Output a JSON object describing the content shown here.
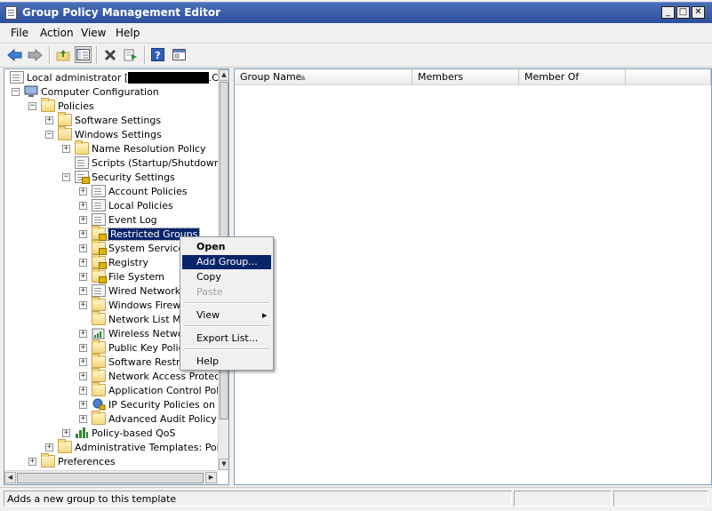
{
  "window": {
    "title": "Group Policy Management Editor"
  },
  "caption_buttons": {
    "minimize": "_",
    "maximize": "□",
    "close": "✕"
  },
  "menubar": [
    "File",
    "Action",
    "View",
    "Help"
  ],
  "toolbar": [
    "back-icon",
    "forward-icon",
    "up-folder-icon",
    "show-hide-tree-icon",
    "delete-icon",
    "export-list-icon",
    "help-icon",
    "properties-icon"
  ],
  "tree": {
    "root": {
      "prefix": "Local administrator [",
      "redacted": "XXXXXXXXXXXX",
      "suffix": ".COM] P"
    },
    "items": [
      {
        "label": "Computer Configuration"
      },
      {
        "label": "Policies"
      },
      {
        "label": "Software Settings"
      },
      {
        "label": "Windows Settings"
      },
      {
        "label": "Name Resolution Policy"
      },
      {
        "label": "Scripts (Startup/Shutdown)"
      },
      {
        "label": "Security Settings"
      },
      {
        "label": "Account Policies"
      },
      {
        "label": "Local Policies"
      },
      {
        "label": "Event Log"
      },
      {
        "label": "Restricted Groups"
      },
      {
        "label": "System Services"
      },
      {
        "label": "Registry"
      },
      {
        "label": "File System"
      },
      {
        "label": "Wired Network ("
      },
      {
        "label": "Windows Firewa"
      },
      {
        "label": "Network List Ma"
      },
      {
        "label": "Wireless Networ"
      },
      {
        "label": "Public Key Policie"
      },
      {
        "label": "Software Restric"
      },
      {
        "label": "Network Access Protecti"
      },
      {
        "label": "Application Control Polici"
      },
      {
        "label": "IP Security Policies on Ac"
      },
      {
        "label": "Advanced Audit Policy C"
      },
      {
        "label": "Policy-based QoS"
      },
      {
        "label": "Administrative Templates: Policy"
      },
      {
        "label": "Preferences"
      }
    ]
  },
  "list": {
    "columns": [
      "Group Name",
      "Members",
      "Member Of"
    ]
  },
  "context_menu": {
    "items": [
      "Open",
      "Add Group...",
      "Copy",
      "Paste",
      "View",
      "Export List...",
      "Help"
    ]
  },
  "status": {
    "text": "Adds a new group to this template"
  },
  "colors": {
    "selection": "#0a246a",
    "title_bar": "#2b4f9c"
  }
}
